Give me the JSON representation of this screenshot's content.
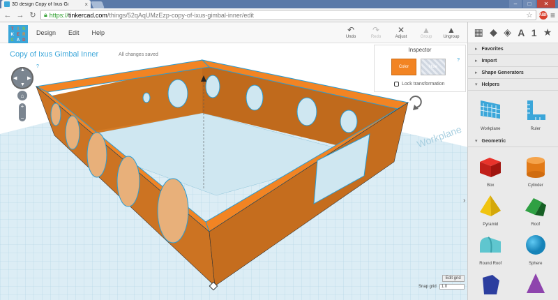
{
  "browser": {
    "tab_title": "3D design Copy of Ixus Gi",
    "url_scheme": "https://",
    "url_host": "tinkercad.com",
    "url_path": "/things/52qAqUMzEzp-copy-of-ixus-gimbal-inner/edit",
    "ext_badge": "ABP"
  },
  "app": {
    "logo_letters": [
      "T",
      "I",
      "N",
      "K",
      "E",
      "R",
      "C",
      "A",
      "D"
    ],
    "menus": [
      "Design",
      "Edit",
      "Help"
    ],
    "toolbar": [
      {
        "label": "Undo",
        "icon": "↶",
        "enabled": true
      },
      {
        "label": "Redo",
        "icon": "↷",
        "enabled": false
      },
      {
        "label": "Adjust",
        "icon": "✕",
        "enabled": true
      },
      {
        "label": "Group",
        "icon": "▲",
        "enabled": false
      },
      {
        "label": "Ungroup",
        "icon": "▲",
        "enabled": true
      }
    ],
    "view_icons": [
      "▦",
      "◆",
      "◈",
      "A",
      "1",
      "★"
    ]
  },
  "canvas": {
    "design_title": "Copy of Ixus Gimbal Inner",
    "save_status": "All changes saved",
    "help_mark": "?",
    "workplane_text": "Workplane"
  },
  "inspector": {
    "title": "Inspector",
    "color_label": "Color",
    "hole_label": "Hole",
    "help": "?",
    "lock_label": "Lock transformation"
  },
  "grid": {
    "edit_label": "Edit grid",
    "snap_label": "Snap grid",
    "snap_value": "1.0"
  },
  "panel": {
    "sections": [
      {
        "label": "Favorites",
        "open": false
      },
      {
        "label": "Import",
        "open": false
      },
      {
        "label": "Shape Generators",
        "open": false
      },
      {
        "label": "Helpers",
        "open": true
      }
    ],
    "helpers": [
      {
        "label": "Workplane",
        "icon": "workplane-icon"
      },
      {
        "label": "Ruler",
        "icon": "ruler-icon"
      }
    ],
    "geometric_label": "Geometric",
    "geometric": [
      {
        "label": "Box",
        "icon": "box-icon"
      },
      {
        "label": "Cylinder",
        "icon": "cylinder-icon"
      },
      {
        "label": "Pyramid",
        "icon": "pyramid-icon"
      },
      {
        "label": "Roof",
        "icon": "roof-icon"
      },
      {
        "label": "Round Roof",
        "icon": "round-roof-icon"
      },
      {
        "label": "Sphere",
        "icon": "sphere-icon"
      }
    ]
  },
  "colors": {
    "accent": "#3ba6d9",
    "shape": "#f28423",
    "grid": "#b8d6e6"
  }
}
